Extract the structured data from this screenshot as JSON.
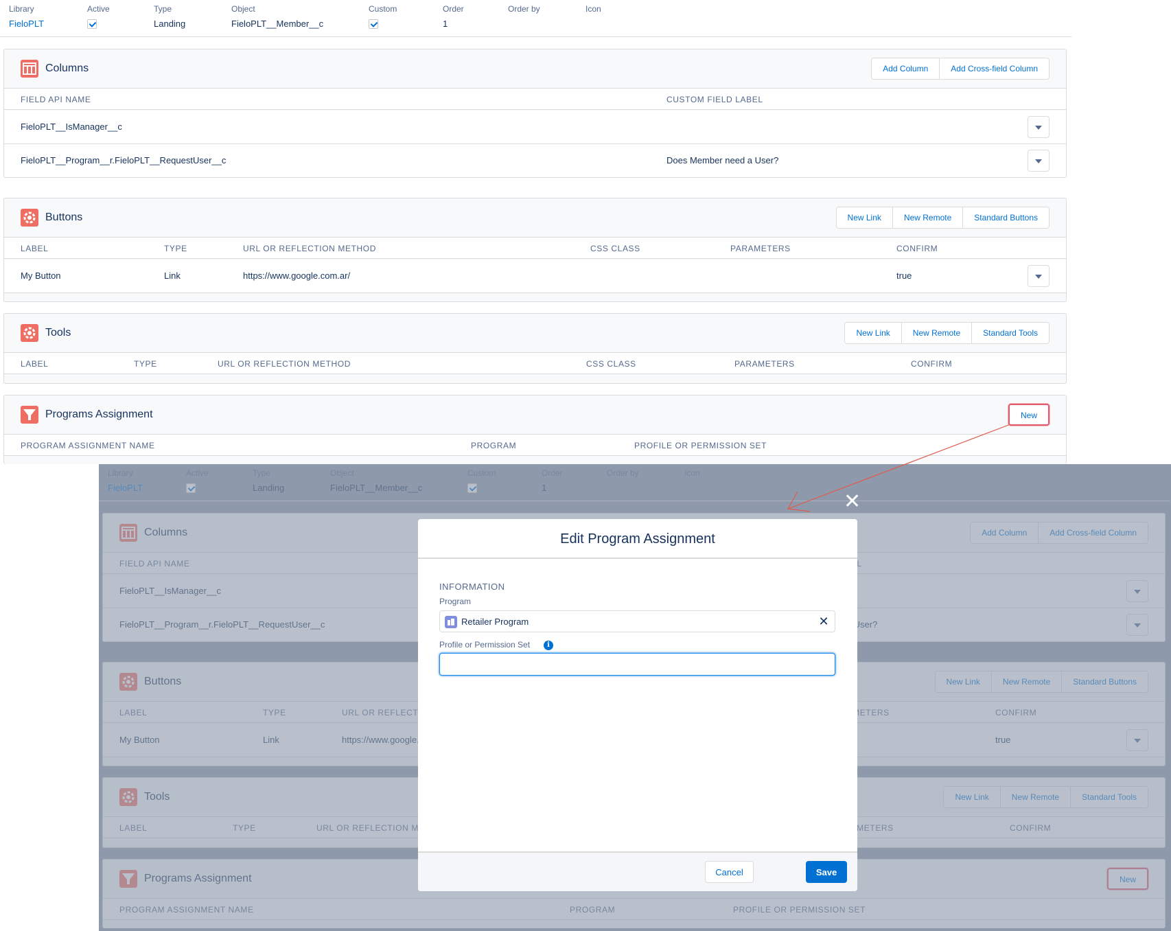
{
  "header": {
    "library": {
      "label": "Library",
      "value": "FieloPLT"
    },
    "active": {
      "label": "Active"
    },
    "type": {
      "label": "Type",
      "value": "Landing"
    },
    "object": {
      "label": "Object",
      "value": "FieloPLT__Member__c"
    },
    "custom": {
      "label": "Custom"
    },
    "order": {
      "label": "Order",
      "value": "1"
    },
    "order_by": {
      "label": "Order by"
    },
    "icon": {
      "label": "Icon"
    }
  },
  "columns_card": {
    "title": "Columns",
    "icon": "table-icon",
    "buttons": [
      "Add Column",
      "Add Cross-field Column"
    ],
    "headers": [
      "FIELD API NAME",
      "CUSTOM FIELD LABEL"
    ],
    "rows": [
      [
        "FieloPLT__IsManager__c",
        ""
      ],
      [
        "FieloPLT__Program__r.FieloPLT__RequestUser__c",
        "Does Member need a User?"
      ]
    ]
  },
  "buttons_card": {
    "title": "Buttons",
    "icon": "gear-icon",
    "buttons": [
      "New Link",
      "New Remote",
      "Standard Buttons"
    ],
    "headers": [
      "LABEL",
      "TYPE",
      "URL OR REFLECTION METHOD",
      "CSS CLASS",
      "PARAMETERS",
      "CONFIRM"
    ],
    "rows": [
      [
        "My Button",
        "Link",
        "https://www.google.com.ar/",
        "",
        "",
        "true"
      ]
    ]
  },
  "tools_card": {
    "title": "Tools",
    "icon": "gear-icon",
    "buttons": [
      "New Link",
      "New Remote",
      "Standard Tools"
    ],
    "headers": [
      "LABEL",
      "TYPE",
      "URL OR REFLECTION METHOD",
      "CSS CLASS",
      "PARAMETERS",
      "CONFIRM"
    ]
  },
  "programs_card": {
    "title": "Programs Assignment",
    "icon": "funnel-icon",
    "buttons": [
      "New"
    ],
    "headers": [
      "PROGRAM ASSIGNMENT NAME",
      "PROGRAM",
      "PROFILE OR PERMISSION SET"
    ]
  },
  "modal": {
    "title": "Edit Program Assignment",
    "close_glyph": "✕",
    "section": "INFORMATION",
    "program_label": "Program",
    "program_value": "Retailer Program",
    "remove_glyph": "✕",
    "profile_label": "Profile or Permission Set",
    "info_glyph": "i",
    "profile_value": "",
    "cancel": "Cancel",
    "save": "Save"
  },
  "colors": {
    "accent": "#0070d2",
    "icon_bg": "#ef6e64",
    "highlight": "#e35a6c",
    "backdrop": "#8e9aab"
  }
}
